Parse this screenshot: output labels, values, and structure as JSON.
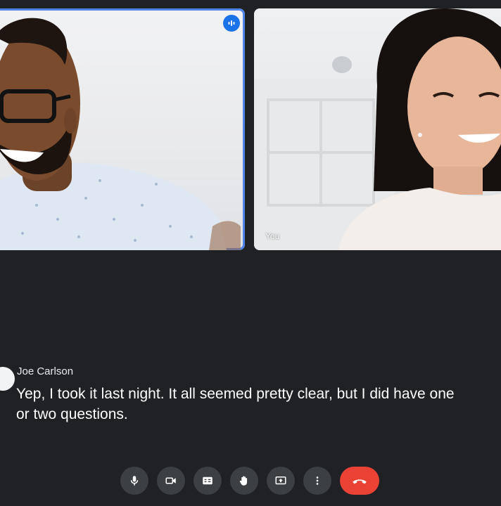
{
  "participants": [
    {
      "label": "",
      "speaking": true
    },
    {
      "label": "You",
      "speaking": false
    }
  ],
  "caption": {
    "speaker": "Joe Carlson",
    "line1": "Yep, I took it last night. It all seemed pretty clear, but I did have one",
    "line2": "or two questions."
  },
  "controls": [
    "microphone-icon",
    "camera-icon",
    "captions-icon",
    "raise-hand-icon",
    "present-screen-icon",
    "more-options-icon",
    "end-call-icon"
  ],
  "colors": {
    "background": "#202124",
    "control": "#3c4043",
    "end_call": "#ea4335",
    "speaking_accent": "#1a73e8"
  }
}
